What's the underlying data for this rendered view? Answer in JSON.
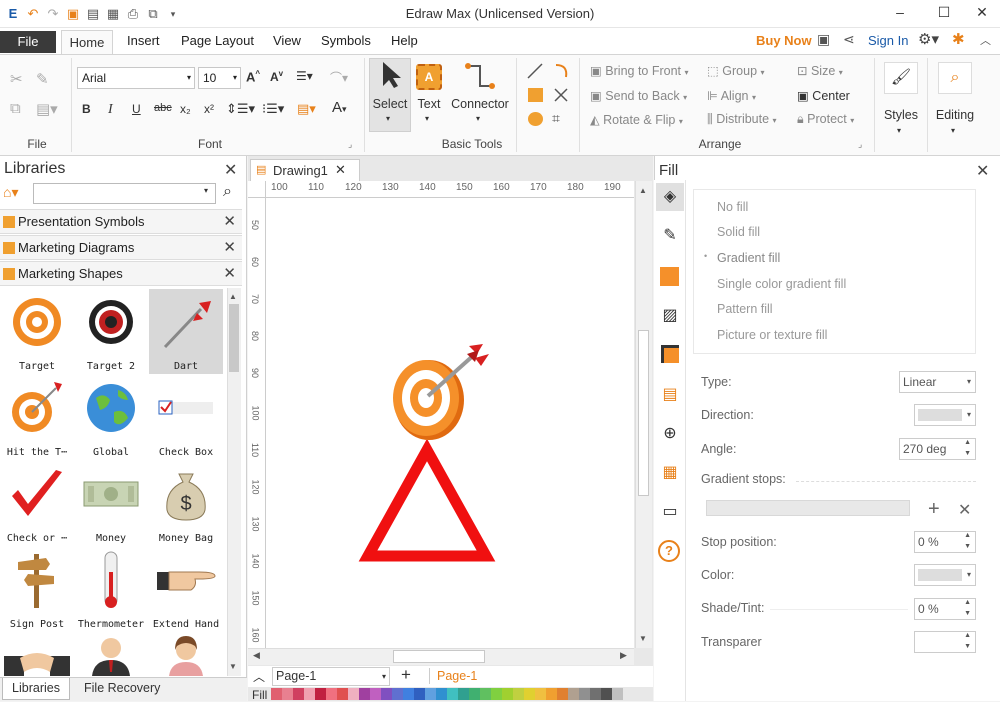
{
  "window": {
    "title": "Edraw Max (Unlicensed Version)"
  },
  "menu": {
    "file": "File",
    "tabs": [
      "Home",
      "Insert",
      "Page Layout",
      "View",
      "Symbols",
      "Help"
    ],
    "buy_now": "Buy Now",
    "sign_in": "Sign In"
  },
  "ribbon": {
    "file_group": "File",
    "font": {
      "name": "Arial",
      "size": "10",
      "label": "Font"
    },
    "basic_tools": {
      "select": "Select",
      "text": "Text",
      "connector": "Connector",
      "label": "Basic Tools"
    },
    "arrange": {
      "bring_front": "Bring to Front",
      "send_back": "Send to Back",
      "rotate_flip": "Rotate & Flip",
      "group": "Group",
      "align": "Align",
      "distribute": "Distribute",
      "size": "Size",
      "center": "Center",
      "protect": "Protect",
      "label": "Arrange"
    },
    "styles": "Styles",
    "editing": "Editing"
  },
  "libraries": {
    "title": "Libraries",
    "search_placeholder": "",
    "sections": [
      "Presentation Symbols",
      "Marketing Diagrams",
      "Marketing Shapes"
    ],
    "shapes": [
      "Target",
      "Target 2",
      "Dart",
      "Hit the T⋯",
      "Global",
      "Check Box",
      "Check or ⋯",
      "Money",
      "Money Bag",
      "Sign Post",
      "Thermometer",
      "Extend Hand"
    ],
    "bottom_tabs": [
      "Libraries",
      "File Recovery"
    ]
  },
  "document": {
    "tab": "Drawing1",
    "ruler_h": [
      "100",
      "110",
      "120",
      "130",
      "140",
      "150",
      "160",
      "170",
      "180",
      "190"
    ],
    "ruler_v": [
      "50",
      "60",
      "70",
      "80",
      "90",
      "100",
      "110",
      "120",
      "130",
      "140",
      "150",
      "160"
    ],
    "page_select": "Page-1",
    "page_tab": "Page-1",
    "fill_label": "Fill"
  },
  "fill_panel": {
    "title": "Fill",
    "options": [
      "No fill",
      "Solid fill",
      "Gradient fill",
      "Single color gradient fill",
      "Pattern fill",
      "Picture or texture fill"
    ],
    "selected_option": "Gradient fill",
    "type_label": "Type:",
    "type_value": "Linear",
    "direction_label": "Direction:",
    "angle_label": "Angle:",
    "angle_value": "270 deg",
    "gradient_stops_label": "Gradient stops:",
    "stop_position_label": "Stop position:",
    "stop_position_value": "0 %",
    "color_label": "Color:",
    "shade_label": "Shade/Tint:",
    "shade_value": "0 %",
    "transparency_label": "Transparer"
  },
  "colors": {
    "accent_orange": "#e8811a",
    "brand_blue": "#1a5aa8"
  }
}
